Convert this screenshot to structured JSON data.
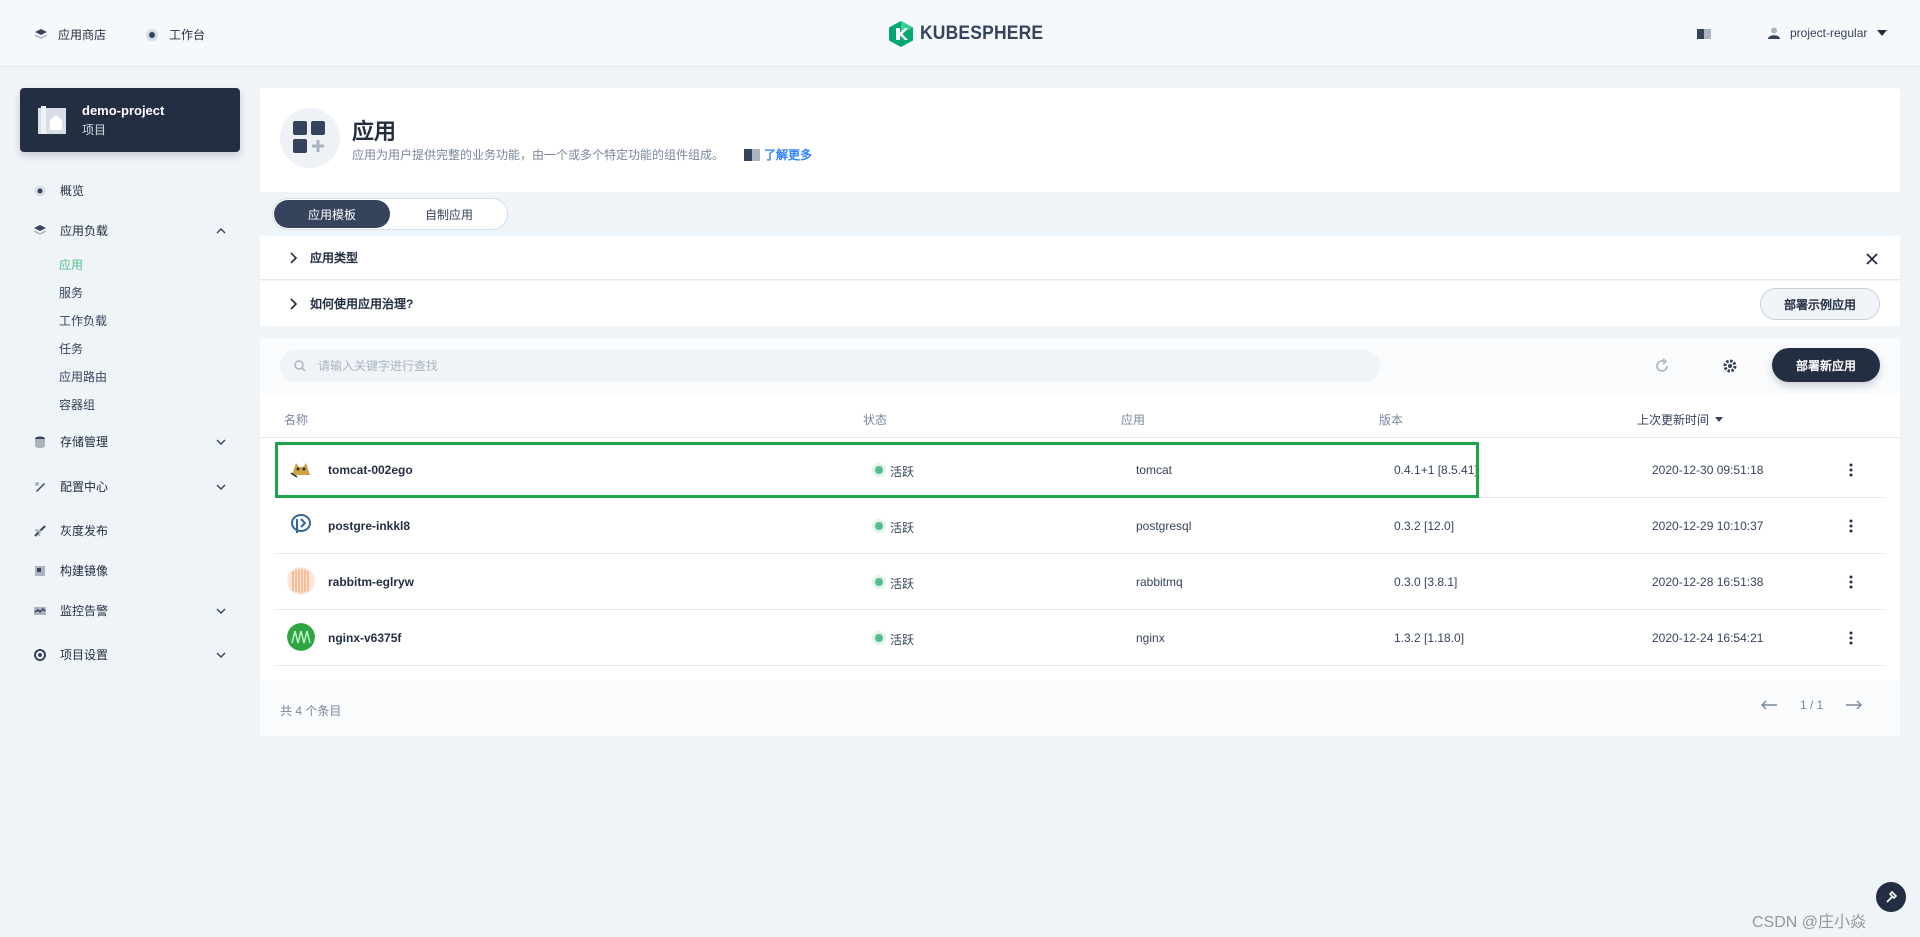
{
  "header": {
    "nav": [
      {
        "label": "应用商店",
        "icon": "app-store-icon"
      },
      {
        "label": "工作台",
        "icon": "workbench-icon"
      }
    ],
    "logo_text": "KUBESPHERE",
    "user": "project-regular"
  },
  "project": {
    "name": "demo-project",
    "type": "项目"
  },
  "sidebar": {
    "items": [
      {
        "label": "概览",
        "icon": "overview-icon"
      },
      {
        "label": "应用负载",
        "icon": "app-workload-icon",
        "expanded": true
      },
      {
        "label": "存储管理",
        "icon": "storage-icon"
      },
      {
        "label": "配置中心",
        "icon": "config-icon"
      },
      {
        "label": "灰度发布",
        "icon": "grayscale-release-icon"
      },
      {
        "label": "构建镜像",
        "icon": "build-image-icon"
      },
      {
        "label": "监控告警",
        "icon": "monitoring-icon"
      },
      {
        "label": "项目设置",
        "icon": "project-settings-icon"
      }
    ],
    "sub_items": [
      "应用",
      "服务",
      "工作负载",
      "任务",
      "应用路由",
      "容器组"
    ],
    "active_sub": "应用"
  },
  "page": {
    "title": "应用",
    "description": "应用为用户提供完整的业务功能，由一个或多个特定功能的组件组成。",
    "learn_more": "了解更多"
  },
  "tabs": [
    {
      "label": "应用模板",
      "active": true
    },
    {
      "label": "自制应用",
      "active": false
    }
  ],
  "tips": [
    {
      "label": "应用类型"
    },
    {
      "label": "如何使用应用治理?"
    }
  ],
  "deploy_sample_label": "部署示例应用",
  "toolbar": {
    "search_placeholder": "请输入关键字进行查找",
    "deploy_new_label": "部署新应用"
  },
  "table": {
    "columns": [
      "名称",
      "状态",
      "应用",
      "版本",
      "上次更新时间"
    ],
    "rows": [
      {
        "name": "tomcat-002ego",
        "status": "活跃",
        "app": "tomcat",
        "version": "0.4.1+1 [8.5.41]",
        "updated": "2020-12-30 09:51:18",
        "icon": "tomcat-icon"
      },
      {
        "name": "postgre-inkkl8",
        "status": "活跃",
        "app": "postgresql",
        "version": "0.3.2 [12.0]",
        "updated": "2020-12-29 10:10:37",
        "icon": "postgresql-icon"
      },
      {
        "name": "rabbitm-eglryw",
        "status": "活跃",
        "app": "rabbitmq",
        "version": "0.3.0 [3.8.1]",
        "updated": "2020-12-28 16:51:38",
        "icon": "rabbitmq-icon"
      },
      {
        "name": "nginx-v6375f",
        "status": "活跃",
        "app": "nginx",
        "version": "1.3.2 [1.18.0]",
        "updated": "2020-12-24 16:54:21",
        "icon": "nginx-icon"
      }
    ],
    "total": "共 4 个条目",
    "page": "1 / 1"
  },
  "colors": {
    "accent": "#55bc8a",
    "dark": "#242e42",
    "highlight": "#1fa34a"
  },
  "watermark": "CSDN @庄小焱"
}
